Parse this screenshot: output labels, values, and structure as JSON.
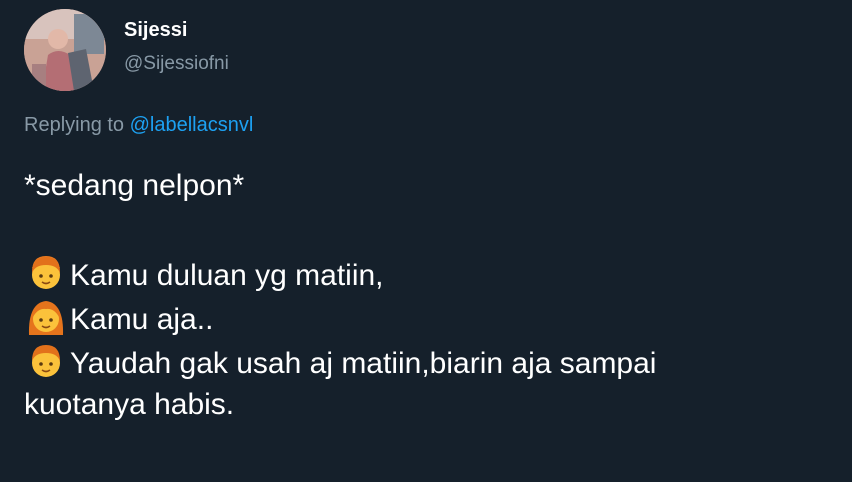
{
  "tweet": {
    "display_name": "Sijessi",
    "handle": "@Sijessiofni",
    "replying_prefix": "Replying to",
    "replying_to": "@labellacsnvl",
    "text": {
      "line1": "*sedang nelpon*",
      "line2": "Kamu duluan yg matiin,",
      "line3": "Kamu aja..",
      "line4": "Yaudah gak usah aj matiin,biarin aja sampai",
      "line5": "kuotanya habis."
    },
    "icons": {
      "avatar": "profile-photo",
      "emoji_1": "boy-emoji",
      "emoji_2": "girl-emoji",
      "emoji_3": "boy-emoji"
    }
  },
  "colors": {
    "background": "#15202b",
    "primary_text": "#ffffff",
    "secondary_text": "#8899a6",
    "mention": "#1da1f2"
  }
}
